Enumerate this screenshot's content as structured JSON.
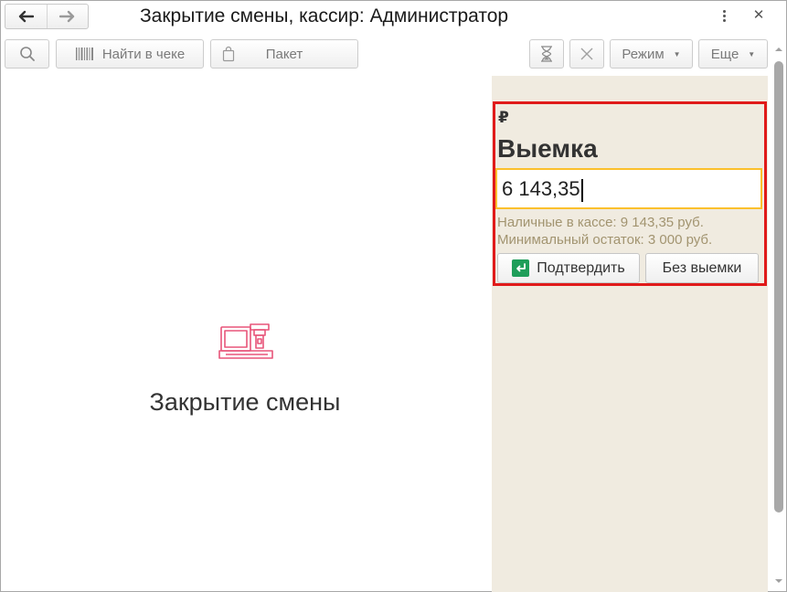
{
  "window": {
    "title": "Закрытие смены, кассир: Администратор"
  },
  "toolbar": {
    "find_in_receipt_label": "Найти в чеке",
    "package_label": "Пакет",
    "mode_label": "Режим",
    "more_label": "Еще"
  },
  "main": {
    "empty_title": "Закрытие смены"
  },
  "panel": {
    "currency_symbol": "₽",
    "heading": "Выемка",
    "amount_value": "6 143,35",
    "cash_in_register": "Наличные в кассе: 9 143,35 руб.",
    "min_balance": "Минимальный остаток: 3 000 руб.",
    "confirm_label": "Подтвердить",
    "no_withdrawal_label": "Без выемки"
  },
  "colors": {
    "accent_red": "#e01a1a",
    "input_focus": "#fbc02d",
    "panel_bg": "#f0ebe0",
    "confirm_icon_green": "#1f9e5a",
    "empty_icon_pink": "#e8557a"
  }
}
